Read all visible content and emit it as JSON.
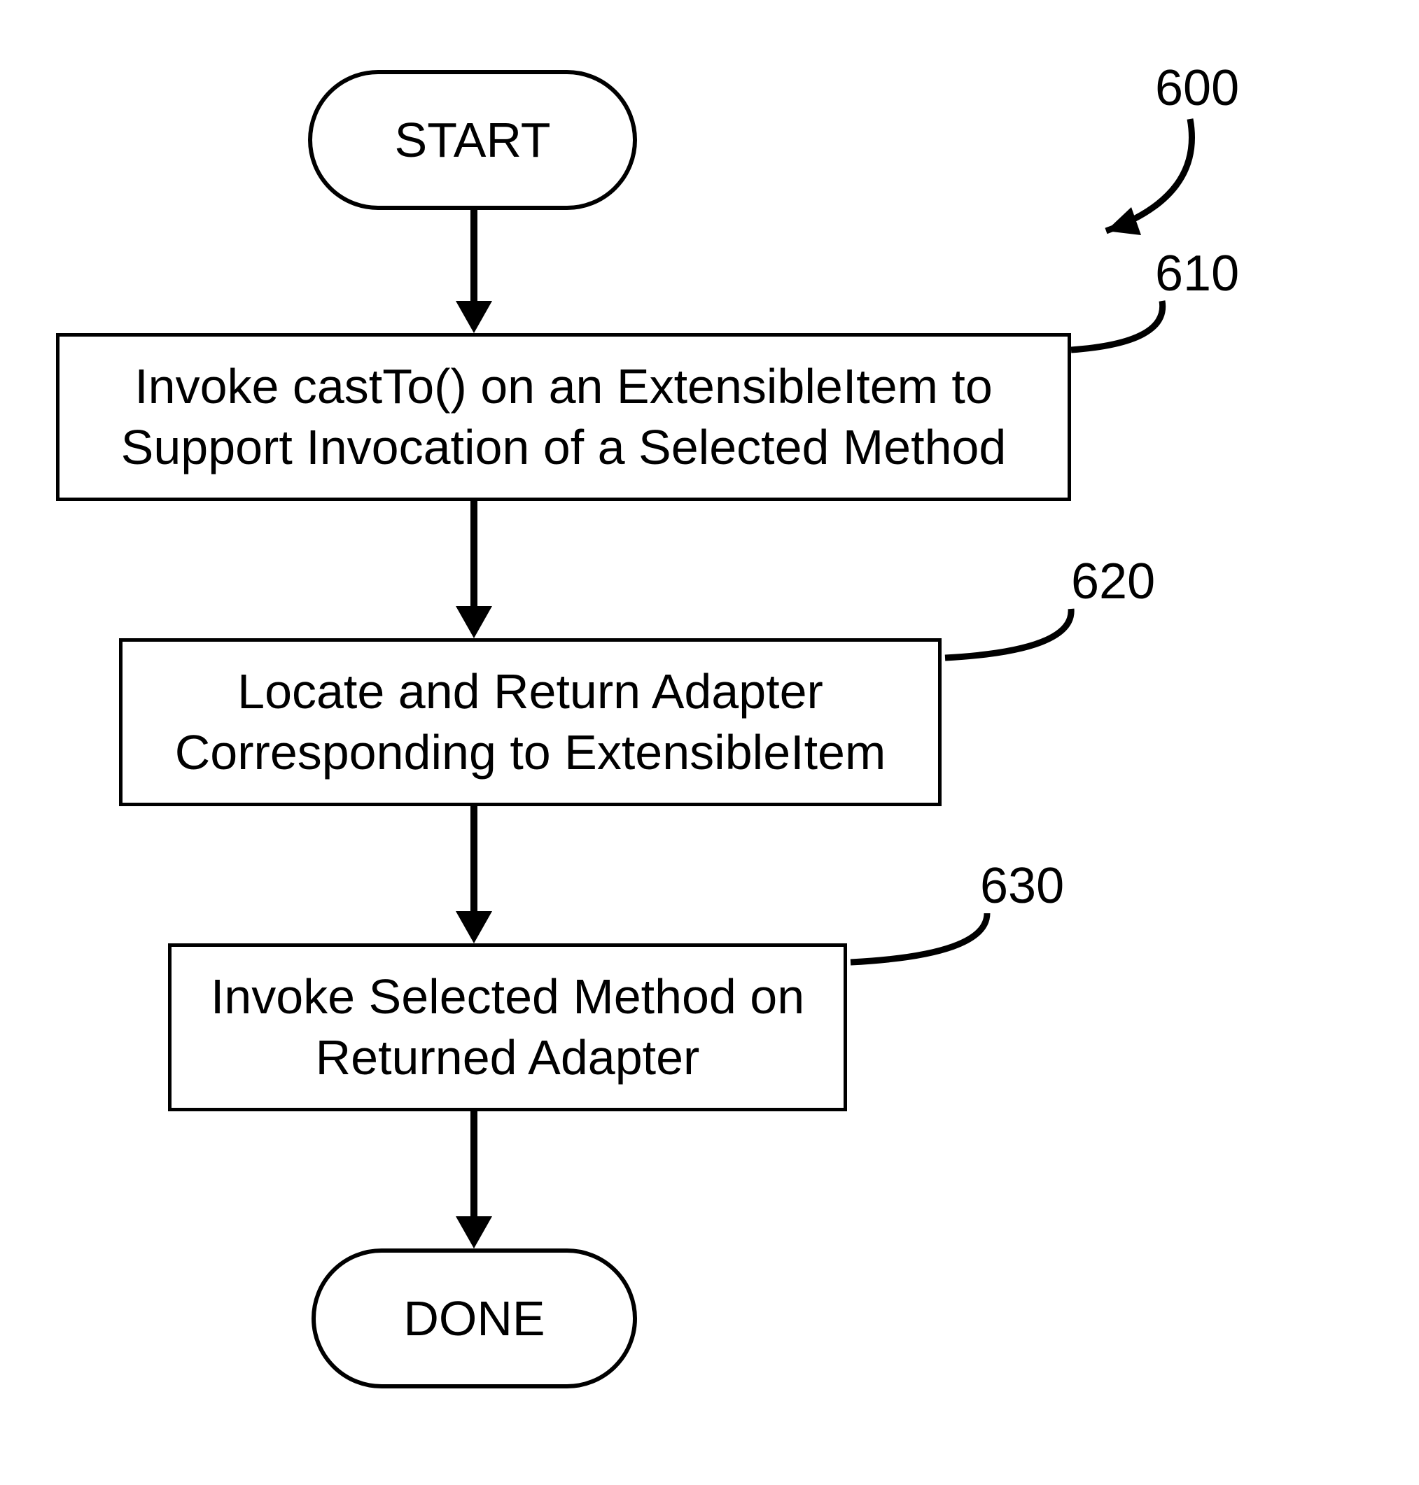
{
  "flow": {
    "start": "START",
    "done": "DONE",
    "step1": "Invoke castTo() on an ExtensibleItem to Support Invocation of a Selected Method",
    "step2": "Locate and Return Adapter Corresponding to ExtensibleItem",
    "step3": "Invoke Selected Method on Returned Adapter"
  },
  "refs": {
    "diagram": "600",
    "r1": "610",
    "r2": "620",
    "r3": "630"
  }
}
